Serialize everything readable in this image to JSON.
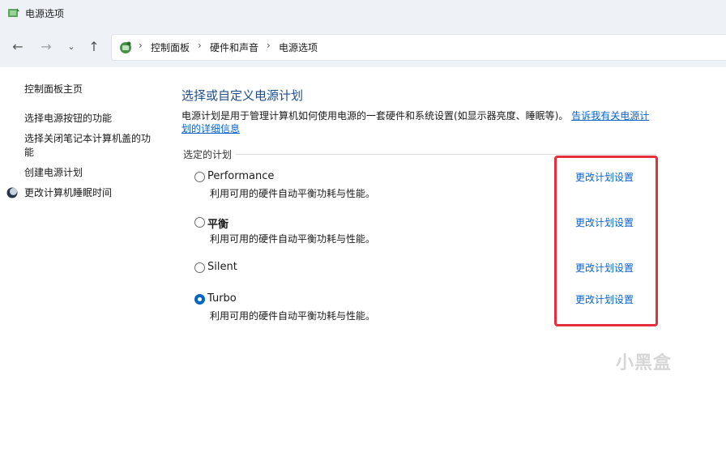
{
  "window": {
    "title": "电源选项"
  },
  "breadcrumb": [
    "控制面板",
    "硬件和声音",
    "电源选项"
  ],
  "sidebar": {
    "items": [
      {
        "label": "控制面板主页"
      },
      {
        "label": "选择电源按钮的功能"
      },
      {
        "label": "选择关闭笔记本计算机盖的功能"
      },
      {
        "label": "创建电源计划"
      },
      {
        "label": "更改计算机睡眠时间"
      }
    ]
  },
  "main": {
    "heading": "选择或自定义电源计划",
    "description": "电源计划是用于管理计算机如何使用电源的一套硬件和系统设置(如显示器亮度、睡眠等)。",
    "description_link": "告诉我有关电源计划的详细信息",
    "group_label": "选定的计划",
    "plans": [
      {
        "name": "Performance",
        "desc": "利用可用的硬件自动平衡功耗与性能。",
        "selected": false,
        "change_label": "更改计划设置"
      },
      {
        "name": "平衡",
        "desc": "利用可用的硬件自动平衡功耗与性能。",
        "selected": false,
        "change_label": "更改计划设置"
      },
      {
        "name": "Silent",
        "desc": "",
        "selected": false,
        "change_label": "更改计划设置"
      },
      {
        "name": "Turbo",
        "desc": "利用可用的硬件自动平衡功耗与性能。",
        "selected": true,
        "change_label": "更改计划设置"
      }
    ]
  },
  "watermark": "小黑盒",
  "colors": {
    "link": "#0a63c9",
    "heading": "#1f4e8c",
    "highlight": "#e3303a",
    "accent": "#0067c0"
  }
}
